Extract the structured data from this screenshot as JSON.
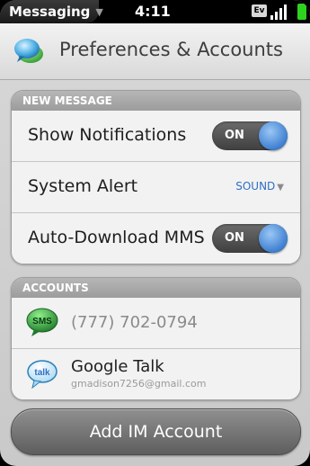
{
  "status_bar": {
    "app_name": "Messaging",
    "time": "4:11",
    "network_badge": "Ev",
    "icons": [
      "app-menu-chevron-icon",
      "ev-network-icon",
      "signal-icon",
      "battery-icon"
    ]
  },
  "header": {
    "title": "Preferences & Accounts",
    "icon": "messaging-icon"
  },
  "new_message": {
    "section_title": "NEW MESSAGE",
    "show_notifications": {
      "label": "Show Notifications",
      "value": "ON"
    },
    "system_alert": {
      "label": "System Alert",
      "value": "SOUND"
    },
    "auto_download_mms": {
      "label": "Auto-Download MMS",
      "value": "ON"
    }
  },
  "accounts": {
    "section_title": "ACCOUNTS",
    "items": [
      {
        "icon": "sms-icon",
        "icon_text": "SMS",
        "name": "(777) 702-0794"
      },
      {
        "icon": "google-talk-icon",
        "icon_text": "talk",
        "name": "Google Talk",
        "email": "gmadison7256@gmail.com"
      }
    ]
  },
  "add_button": {
    "label": "Add IM Account"
  },
  "colors": {
    "toggle_knob": "#3e7fd0",
    "dropdown_text": "#2f6fc7",
    "battery": "#2fd31f",
    "sms_icon": "#2f8f3a"
  }
}
